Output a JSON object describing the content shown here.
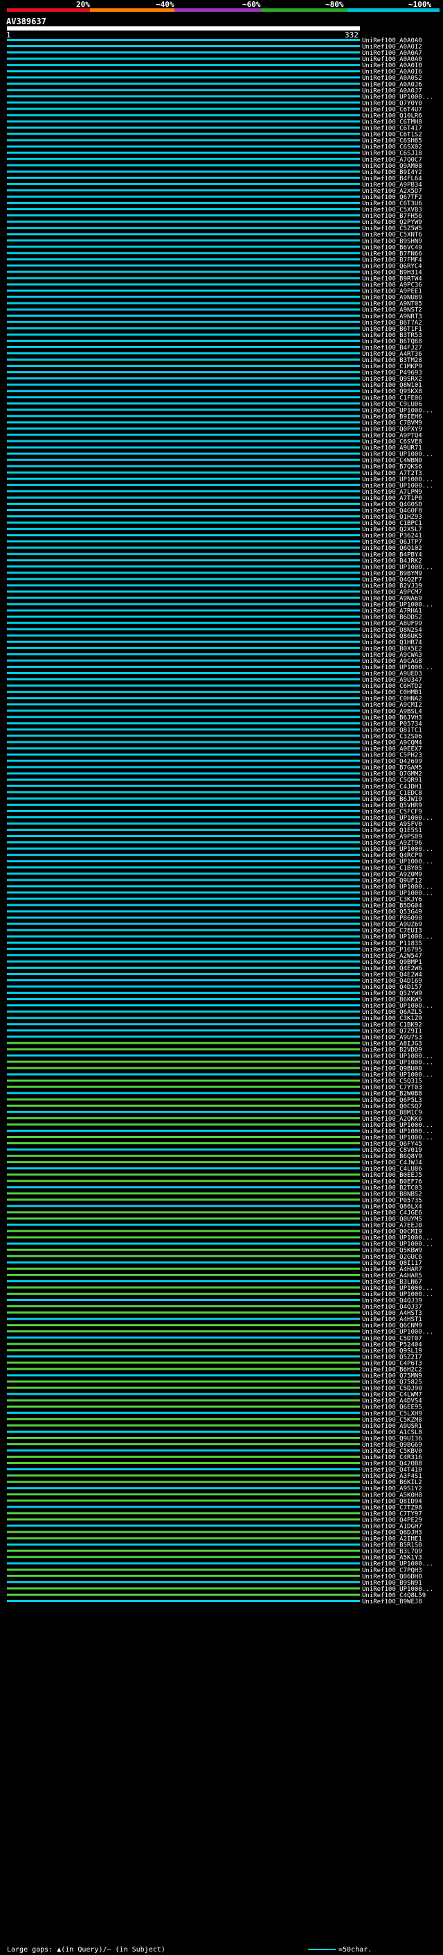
{
  "scale": {
    "labels": [
      "20%",
      "~40%",
      "~60%",
      "~80%",
      "~100%"
    ],
    "colors": [
      "#e8121d",
      "#ff7f00",
      "#9b37b8",
      "#2ba82b",
      "#00c0d8"
    ]
  },
  "query": {
    "id": "AV389637",
    "start": "1",
    "end": "332"
  },
  "hit_colors": {
    "cyan": "#00d0e8",
    "green": "#55d23c"
  },
  "hits": [
    "UniRef100_A0A0A0",
    "UniRef100_A0A0I2",
    "UniRef100_A0A0A7",
    "UniRef100_A0A0A0",
    "UniRef100_A0A0I0",
    "UniRef100_A0A0I6",
    "UniRef100_A0A0S2",
    "UniRef100_A0A0J6",
    "UniRef100_A0A0J7",
    "UniRef100_UP1000...",
    "UniRef100_Q7Y0Y0",
    "UniRef100_C6T4U7",
    "UniRef100_Q10LR6",
    "UniRef100_C6TMH8",
    "UniRef100_C6T417",
    "UniRef100_C6T1S2",
    "UniRef100_C6SH85",
    "UniRef100_C6SX02",
    "UniRef100_C6SJ18",
    "UniRef100_A7Q0C7",
    "UniRef100_Q9AM08",
    "UniRef100_B9I4Y2",
    "UniRef100_B4FL64",
    "UniRef100_A9PB34",
    "UniRef100_A2X5D7",
    "UniRef100_Q67TF2",
    "UniRef100_C6T3U6",
    "UniRef100_C5XVB3",
    "UniRef100_B7FH56",
    "UniRef100_Q2PYW9",
    "UniRef100_C5Z5W5",
    "UniRef100_C5XNT6",
    "UniRef100_B9SHN9",
    "UniRef100_B6VC49",
    "UniRef100_B7FN66",
    "UniRef100_B7FMF4",
    "UniRef100_Q6RYC4",
    "UniRef100_B9H314",
    "UniRef100_B9RTW4",
    "UniRef100_A9PC36",
    "UniRef100_A9PEE1",
    "UniRef100_A9NU89",
    "UniRef100_A9NT05",
    "UniRef100_A9NST2",
    "UniRef100_A9NRT3",
    "UniRef100_B6T7A2",
    "UniRef100_B6T1F1",
    "UniRef100_B3TR53",
    "UniRef100_B6TQ68",
    "UniRef100_B4FJ27",
    "UniRef100_A4RT36",
    "UniRef100_B3TM28",
    "UniRef100_C1MKP9",
    "UniRef100_P49693",
    "UniRef100_Q9SRX2",
    "UniRef100_Q8W101",
    "UniRef100_Q9SKX8",
    "UniRef100_C1FE06",
    "UniRef100_C9LU06",
    "UniRef100_UP1000...",
    "UniRef100_B9IEH6",
    "UniRef100_C7BVM9",
    "UniRef100_Q0PXY9",
    "UniRef100_A9PTQ4",
    "UniRef100_C6SVE8",
    "UniRef100_A9UR71",
    "UniRef100_UP1000...",
    "UniRef100_C4WBN0",
    "UniRef100_B7QKS6",
    "UniRef100_A7T2T3",
    "UniRef100_UP1000...",
    "UniRef100_UP1000...",
    "UniRef100_A7LPM9",
    "UniRef100_A7T1P0",
    "UniRef100_Q4G0S0",
    "UniRef100_Q4G0F8",
    "UniRef100_Q1HZ93",
    "UniRef100_C1BPC1",
    "UniRef100_Q2XSL7",
    "UniRef100_P36241",
    "UniRef100_Q6JTP7",
    "UniRef100_Q6Q102",
    "UniRef100_B4PBY4",
    "UniRef100_B4JRK2",
    "UniRef100_UP1000...",
    "UniRef100_B9BYM9",
    "UniRef100_Q4Q2F7",
    "UniRef100_B2VJ39",
    "UniRef100_A9PCM7",
    "UniRef100_A9NA69",
    "UniRef100_UP1000...",
    "UniRef100_A7RHA1",
    "UniRef100_B6DDS2",
    "UniRef100_A8UF99",
    "UniRef100_Q8N2S4",
    "UniRef100_Q86UK5",
    "UniRef100_Q1HR74",
    "UniRef100_B0X5E2",
    "UniRef100_A9CWA3",
    "UniRef100_A9CAG8",
    "UniRef100_UP1000...",
    "UniRef100_A9UED3",
    "UniRef100_A9U347",
    "UniRef100_C6HTD2",
    "UniRef100_C0HMB1",
    "UniRef100_C0HNA2",
    "UniRef100_A9CMI2",
    "UniRef100_A9BSL4",
    "UniRef100_B6JVH3",
    "UniRef100_P05734",
    "UniRef100_Q81TC1",
    "UniRef100_C3ZS06",
    "UniRef100_A9CQM4",
    "UniRef100_A0EEX7",
    "UniRef100_C5PH23",
    "UniRef100_Q42699",
    "UniRef100_B7GAM5",
    "UniRef100_Q7GMM2",
    "UniRef100_C5QR91",
    "UniRef100_C4JDH1",
    "UniRef100_C1EDC8",
    "UniRef100_B6JW19",
    "UniRef100_Q5VHR9",
    "UniRef100_C5FCF9",
    "UniRef100_UP1000...",
    "UniRef100_A9SFV0",
    "UniRef100_Q1E5S1",
    "UniRef100_A9PS09",
    "UniRef100_A9ZT96",
    "UniRef100_UP1000...",
    "UniRef100_Q4RCP9",
    "UniRef100_UP1000...",
    "UniRef100_C1BY05",
    "UniRef100_A9Z0M9",
    "UniRef100_Q9UF12",
    "UniRef100_UP1000...",
    "UniRef100_UP1000...",
    "UniRef100_C3KJY6",
    "UniRef100_B5DG04",
    "UniRef100_Q53G49",
    "UniRef100_P86098",
    "UniRef100_A9UZ69",
    "UniRef100_C7EUI3",
    "UniRef100_UP1000...",
    "UniRef100_P11835",
    "UniRef100_P16795",
    "UniRef100_A2W547",
    "UniRef100_Q9BMP1",
    "UniRef100_Q4E2W6",
    "UniRef100_Q4E2W4",
    "UniRef100_Q4D169",
    "UniRef100_Q4D157",
    "UniRef100_Q52YW9",
    "UniRef100_B6KKW5",
    "UniRef100_UP1000...",
    "UniRef100_Q6AZL5",
    "UniRef100_C3K1Z9",
    "UniRef100_C1BK92",
    "UniRef100_Q7Z9I1",
    "UniRef100_A9U7S3",
    "UniRef100_A8IJG3",
    "UniRef100_B2VDD9",
    "UniRef100_UP1000...",
    "UniRef100_UP1000...",
    "UniRef100_Q9BU00",
    "UniRef100_UP1000...",
    "UniRef100_C5Q315",
    "UniRef100_C7YT03",
    "UniRef100_B2W0B8",
    "UniRef100_Q6P5L3",
    "UniRef100_Q0CSQ7",
    "UniRef100_B8M1C9",
    "UniRef100_A2QKK6",
    "UniRef100_UP1000...",
    "UniRef100_UP1000...",
    "UniRef100_UP1000...",
    "UniRef100_Q6FY45",
    "UniRef100_C8V019",
    "UniRef100_B6Q8Y9",
    "UniRef100_C4JWJ4",
    "UniRef100_C4LU86",
    "UniRef100_B0EEJ5",
    "UniRef100_B0EF76",
    "UniRef100_B2TC03",
    "UniRef100_B8NBS2",
    "UniRef100_P05735",
    "UniRef100_Q86LX4",
    "UniRef100_C4JGE6",
    "UniRef100_Q0UYM5",
    "UniRef100_A7EEJ0",
    "UniRef100_Q0CMI9",
    "UniRef100_UP1000...",
    "UniRef100_UP1000...",
    "UniRef100_Q5KBW9",
    "UniRef100_Q2GUC6",
    "UniRef100_Q8I117",
    "UniRef100_A4HAR7",
    "UniRef100_A4HAR5",
    "UniRef100_B3LN67",
    "UniRef100_UP1000...",
    "UniRef100_UP1000...",
    "UniRef100_Q4QJ39",
    "UniRef100_Q4QJ37",
    "UniRef100_A4HST3",
    "UniRef100_A4HST1",
    "UniRef100_Q6CNM9",
    "UniRef100_UP1000...",
    "UniRef100_C5DT07",
    "UniRef100_P52404",
    "UniRef100_Q9SL19",
    "UniRef100_Q5Z2I7",
    "UniRef100_C4P6T3",
    "UniRef100_B6H2C2",
    "UniRef100_Q75MN9",
    "UniRef100_Q75825",
    "UniRef100_C5DJ90",
    "UniRef100_C4LWM7",
    "UniRef100_A4DVS4",
    "UniRef100_Q6EE95",
    "UniRef100_C5LXH9",
    "UniRef100_C5KZM8",
    "UniRef100_A9USR1",
    "UniRef100_A1CSL8",
    "UniRef100_Q9UI36",
    "UniRef100_Q9BG69",
    "UniRef100_C5KBV0",
    "UniRef100_C4R316",
    "UniRef100_Q42OB8",
    "UniRef100_Q4T410",
    "UniRef100_A3F4S1",
    "UniRef100_B6KIL2",
    "UniRef100_A9S1Y2",
    "UniRef100_A5K0H8",
    "UniRef100_Q8ID94",
    "UniRef100_C7TZ98",
    "UniRef100_C7TY97",
    "UniRef100_Q4PE29",
    "UniRef100_A1DGH7",
    "UniRef100_Q6DJH3",
    "UniRef100_A2IHE1",
    "UniRef100_B5R1S0",
    "UniRef100_B3L7Q9",
    "UniRef100_A5K1Y3",
    "UniRef100_UP1000...",
    "UniRef100_C7PQH3",
    "UniRef100_Q06DH0",
    "UniRef100_B9SN91",
    "UniRef100_UP1000...",
    "UniRef100_C4Q8L59",
    "UniRef100_B9WEJ8"
  ],
  "footer": {
    "gap_legend": "Large gaps: ▲(in Query)/~ (in Subject)",
    "scale_legend": "=50char."
  }
}
